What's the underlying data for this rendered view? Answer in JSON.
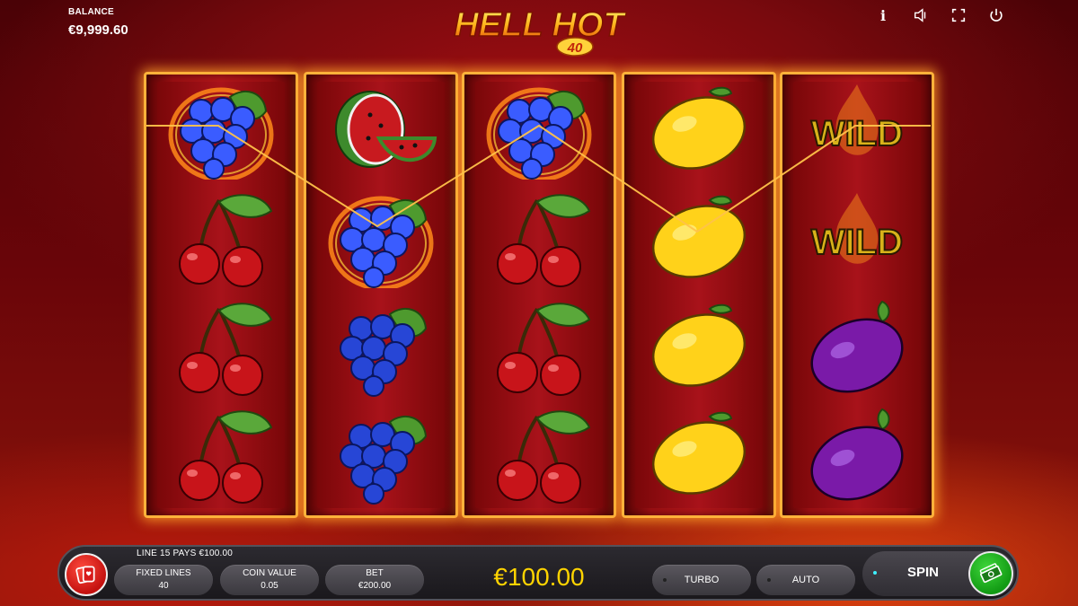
{
  "game": {
    "title": "HELL HOT",
    "subtitle": "40"
  },
  "balance": {
    "label": "BALANCE",
    "value": "€9,999.60"
  },
  "top_icons": [
    "info-icon",
    "sound-icon",
    "fullscreen-icon",
    "power-icon"
  ],
  "top_icon_text": {
    "info": "i"
  },
  "reels": [
    [
      "grapes-win",
      "cherries",
      "cherries",
      "cherries"
    ],
    [
      "watermelon",
      "grapes-win",
      "grapes",
      "grapes"
    ],
    [
      "grapes-win",
      "cherries",
      "cherries",
      "cherries"
    ],
    [
      "lemon",
      "lemon",
      "lemon",
      "lemon"
    ],
    [
      "wild",
      "wild",
      "plum",
      "plum"
    ]
  ],
  "wild_label": "WILD",
  "controls": {
    "line_pays": "LINE 15 PAYS €100.00",
    "fixed_lines_label": "FIXED LINES",
    "fixed_lines_value": "40",
    "coin_value_label": "COIN VALUE",
    "coin_value_value": "0.05",
    "bet_label": "BET",
    "bet_value": "€200.00",
    "win_amount": "€100.00",
    "turbo_label": "TURBO",
    "auto_label": "AUTO",
    "spin_label": "SPIN"
  },
  "colors": {
    "reel_border": "#ffb23a",
    "win_text": "#ffd400",
    "spin_green": "#1fb21c",
    "paytable_red": "#d8191a",
    "payline": "#ffc24a"
  }
}
